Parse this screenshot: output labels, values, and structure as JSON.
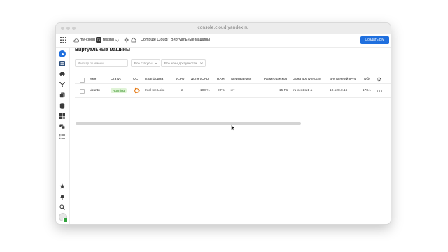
{
  "browser": {
    "url": "console.cloud.yandex.ru"
  },
  "topbar": {
    "cloud_name": "my-cloud",
    "folder_badge": "ТБ",
    "folder_name": "testing",
    "service_name": "Compute Cloud",
    "separator": "/",
    "page_name": "Виртуальные машины",
    "create_button": "Создать ВМ"
  },
  "sidebar": {
    "icons": [
      "logo-icon",
      "dashboard-icon",
      "cars-icon",
      "network-icon",
      "copy-icon",
      "database-icon",
      "grid-icon",
      "chat-icon",
      "list-icon"
    ],
    "bottom_icons": [
      "star-icon",
      "bell-icon",
      "search-icon",
      "help-icon",
      "gear-icon",
      "avatar"
    ]
  },
  "main": {
    "title": "Виртуальные машины",
    "filter_placeholder": "Фильтр по имени",
    "status_select": "Все статусы",
    "zone_select": "Все зоны доступности"
  },
  "table": {
    "headers": [
      "Имя",
      "Статус",
      "ОС",
      "Платформа",
      "vCPU",
      "Доля vCPU",
      "RAM",
      "Прерываемая",
      "Размер дисков",
      "Зона доступности",
      "Внутренний IPv4",
      "Публ"
    ],
    "rows": [
      {
        "name": "ubuntu",
        "status": "Running",
        "os": "ubuntu-icon",
        "platform": "Intel Ice Lake",
        "vcpu": "2",
        "vcpu_share": "100 %",
        "ram": "2 ГБ",
        "preemptible": "нет",
        "disk_size": "15 ГБ",
        "zone": "ru-central1-a",
        "internal_ip": "10.128.0.16",
        "public_ip": "178.1"
      }
    ]
  },
  "colors": {
    "accent": "#1f6fde",
    "running_bg": "#dff3d6",
    "running_text": "#2f8f1f",
    "ubuntu": "#e57a14"
  }
}
